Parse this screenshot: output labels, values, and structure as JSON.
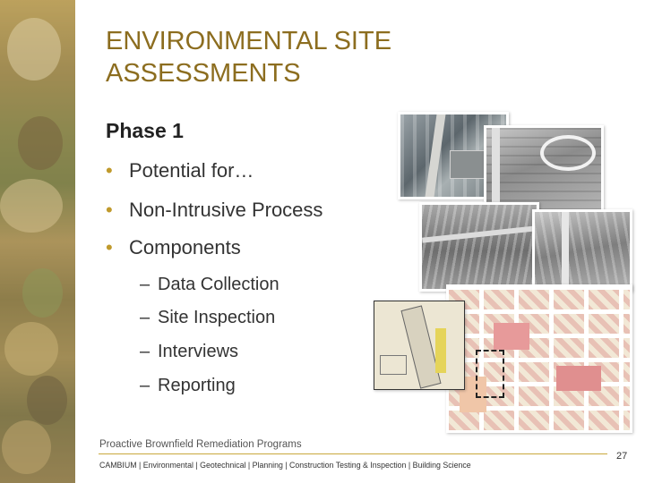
{
  "title": "ENVIRONMENTAL SITE ASSESSMENTS",
  "subhead": "Phase 1",
  "bullets": [
    "Potential for…",
    "Non-Intrusive Process",
    "Components"
  ],
  "bullet_marker": "•",
  "sub_bullets": [
    "Data Collection",
    "Site Inspection",
    "Interviews",
    "Reporting"
  ],
  "sub_marker": "–",
  "footer": {
    "program": "Proactive Brownfield Remediation Programs",
    "categories": "CAMBIUM  |  Environmental  | Geotechnical | Planning  | Construction Testing & Inspection | Building Science",
    "page_number": "27"
  },
  "colors": {
    "title": "#8c6d1f",
    "bullet": "#c09a2c",
    "rule": "#c9a83d"
  }
}
